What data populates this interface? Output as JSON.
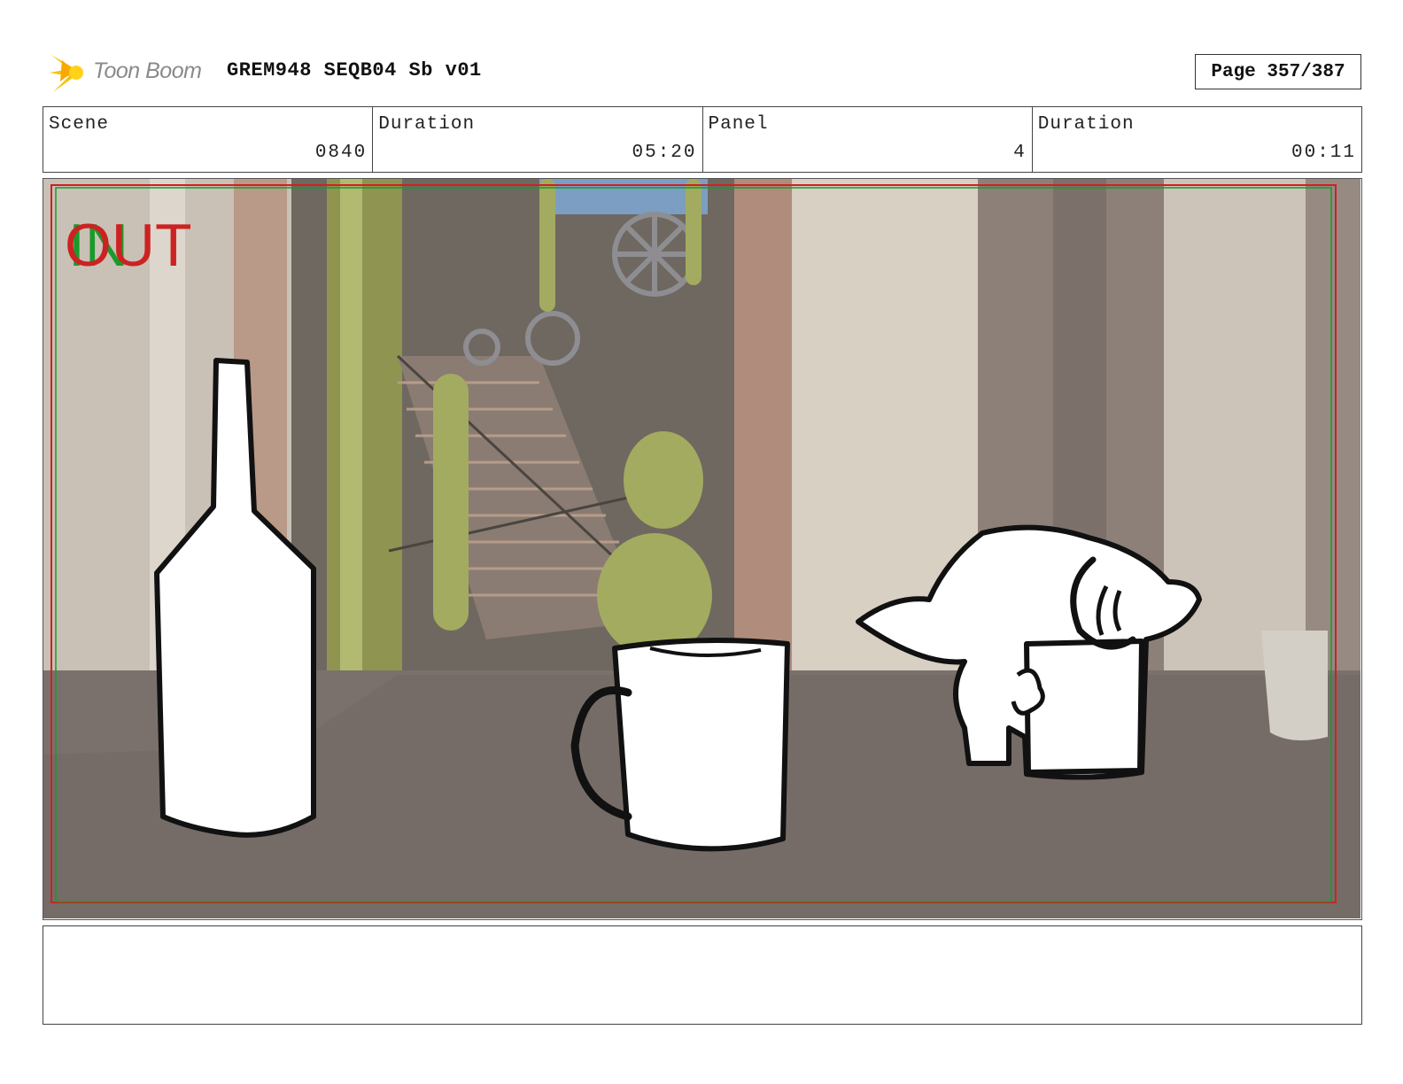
{
  "header": {
    "logo_text": "Toon Boom",
    "title": "GREM948 SEQB04 Sb v01",
    "page": "Page 357/387"
  },
  "info": {
    "scene_label": "Scene",
    "scene_value": "0840",
    "duration_label": "Duration",
    "duration_value": "05:20",
    "panel_label": "Panel",
    "panel_value": "4",
    "panel_duration_label": "Duration",
    "panel_duration_value": "00:11"
  },
  "panel": {
    "in_marker": "IN",
    "out_marker": "OUT"
  },
  "notes": {
    "text": ""
  },
  "colors": {
    "safe_frame_red": "#cc2222",
    "safe_frame_green": "#1a9a2a",
    "logo_yellow": "#f5c400"
  }
}
